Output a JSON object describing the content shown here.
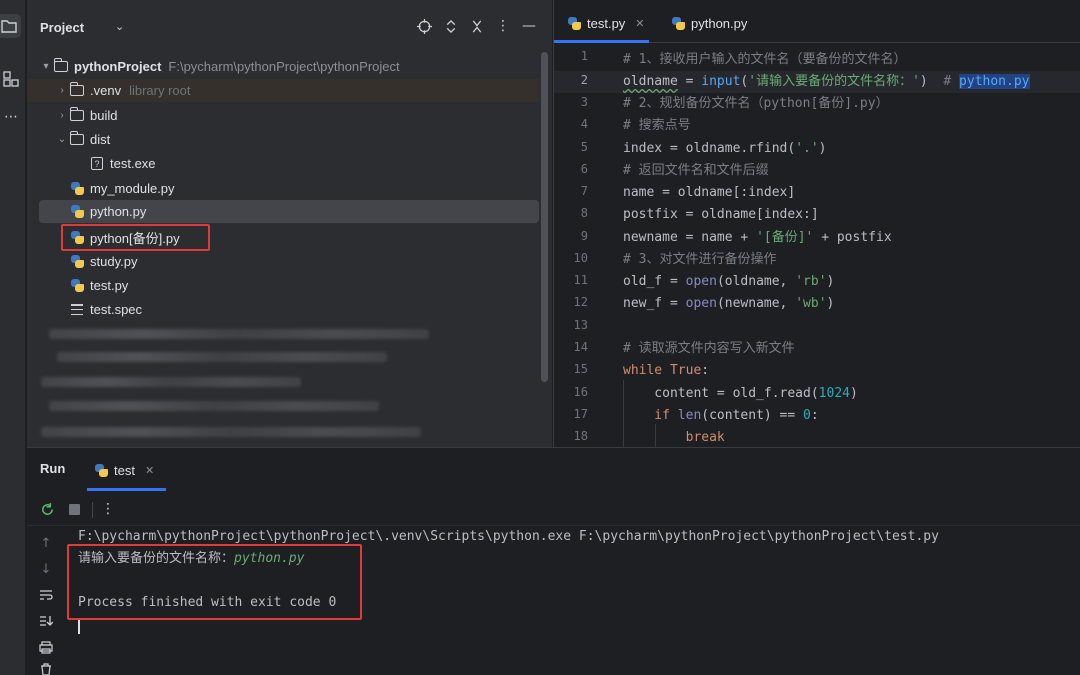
{
  "activity_bar": {
    "icons": [
      "folder-icon",
      "structure-icon",
      "more-icon"
    ]
  },
  "project": {
    "title": "Project",
    "header_icons": [
      "locate-icon",
      "expand-collapse-icon",
      "close-icon",
      "options-icon",
      "minimize-icon"
    ],
    "root": {
      "name": "pythonProject",
      "path": "F:\\pycharm\\pythonProject\\pythonProject"
    },
    "items": [
      {
        "label": ".venv",
        "sub": "library root"
      },
      {
        "label": "build"
      },
      {
        "label": "dist"
      },
      {
        "label": "test.exe"
      },
      {
        "label": "my_module.py"
      },
      {
        "label": "python.py"
      },
      {
        "label": "python[备份].py"
      },
      {
        "label": "study.py"
      },
      {
        "label": "test.py"
      },
      {
        "label": "test.spec"
      }
    ]
  },
  "editor": {
    "tabs": [
      {
        "label": "test.py",
        "active": true
      },
      {
        "label": "python.py",
        "active": false
      }
    ],
    "current_line": 2,
    "line_numbers": [
      "1",
      "2",
      "3",
      "4",
      "5",
      "6",
      "7",
      "8",
      "9",
      "10",
      "11",
      "12",
      "13",
      "14",
      "15",
      "16",
      "17",
      "18"
    ],
    "code": {
      "l1": "# 1、接收用户输入的文件名（要备份的文件名）",
      "l2_var": "oldname",
      "l2_eq": " = ",
      "l2_fn": "input",
      "l2_open": "(",
      "l2_str": "'请输入要备份的文件名称：'",
      "l2_close": ")  ",
      "l2_com": "# ",
      "l2_hl": "python.py",
      "l3": "# 2、规划备份文件名（python[备份].py）",
      "l4": "# 搜索点号",
      "l5_a": "index = oldname.rfind(",
      "l5_str": "'.'",
      "l5_b": ")",
      "l6": "# 返回文件名和文件后缀",
      "l7": "name = oldname[:index]",
      "l8": "postfix = oldname[index:]",
      "l9_a": "newname = name + ",
      "l9_str": "'[备份]'",
      "l9_b": " + postfix",
      "l10": "# 3、对文件进行备份操作",
      "l11_a": "old_f = ",
      "l11_fn": "open",
      "l11_b": "(oldname, ",
      "l11_str": "'rb'",
      "l11_c": ")",
      "l12_a": "new_f = ",
      "l12_fn": "open",
      "l12_b": "(newname, ",
      "l12_str": "'wb'",
      "l12_c": ")",
      "l14": "# 读取源文件内容写入新文件",
      "l15_kw": "while",
      "l15_sp": " ",
      "l15_true": "True",
      "l15_b": ":",
      "l16_a": "    content = old_f.read(",
      "l16_num": "1024",
      "l16_b": ")",
      "l17_kw": "    if",
      "l17_sp": " ",
      "l17_fn": "len",
      "l17_a": "(content) == ",
      "l17_num": "0",
      "l17_b": ":",
      "l18_kw": "        break"
    }
  },
  "run": {
    "title": "Run",
    "tab_label": "test",
    "toolbar_icons": [
      "rerun-icon",
      "stop-icon",
      "more-vertical-icon"
    ],
    "side_icons": [
      "arrow-up-icon",
      "arrow-down-icon",
      "soft-wrap-icon",
      "scroll-to-end-icon",
      "print-icon",
      "trash-icon"
    ],
    "console": {
      "command": "F:\\pycharm\\pythonProject\\pythonProject\\.venv\\Scripts\\python.exe F:\\pycharm\\pythonProject\\pythonProject\\test.py",
      "prompt": "请输入要备份的文件名称：",
      "input": "python.py",
      "exit": "Process finished with exit code 0"
    }
  }
}
